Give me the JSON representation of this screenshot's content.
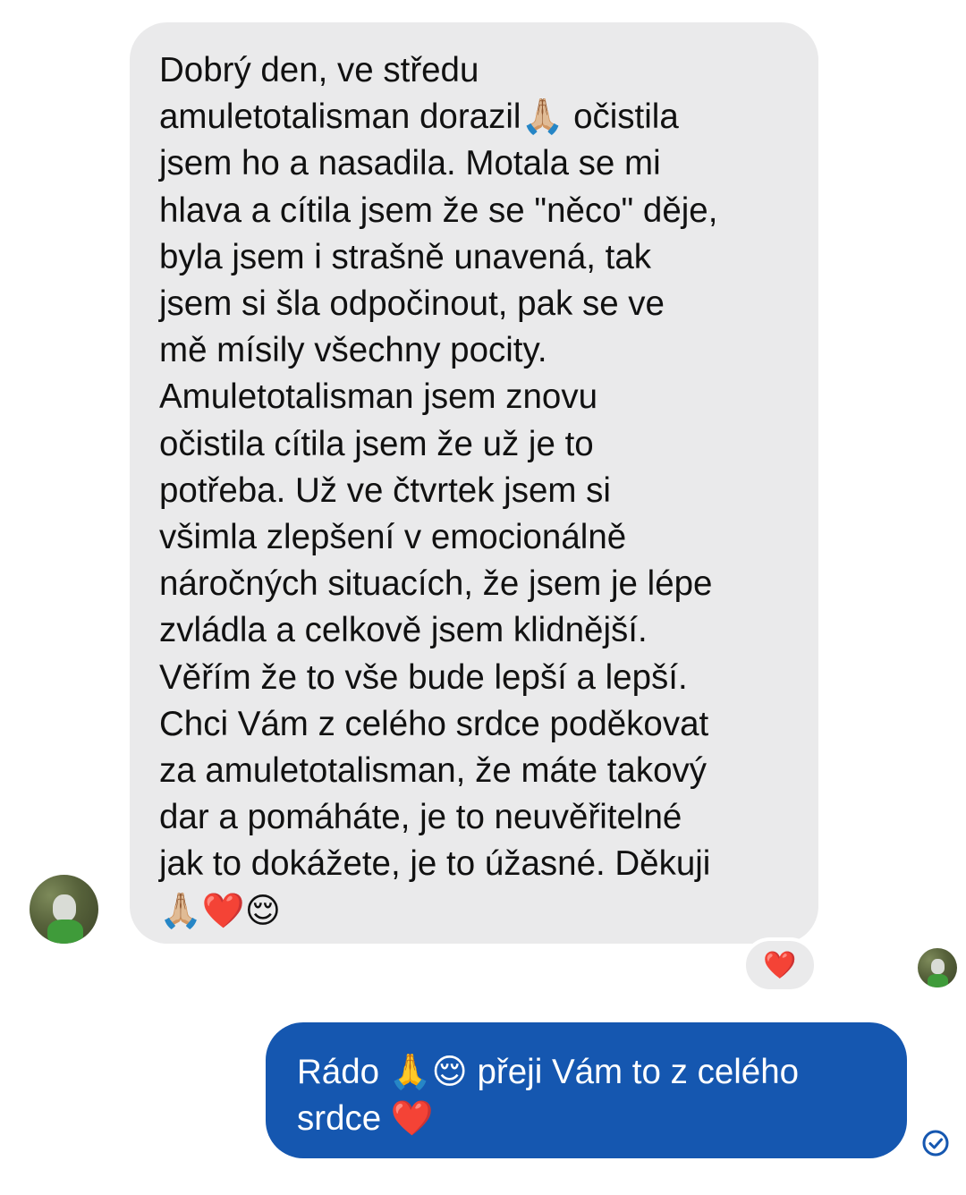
{
  "incoming_message": {
    "text": "Dobrý den, ve středu\namuletotalisman dorazil🙏🏼 očistila\njsem ho a nasadila. Motala se mi\nhlava a cítila jsem že se \"něco\" děje,\nbyla jsem i strašně unavená, tak\njsem si šla odpočinout, pak se ve\nmě mísily všechny pocity.\nAmuletotalisman jsem znovu\nočistila cítila jsem že už je to\npotřeba. Už ve čtvrtek jsem si\nvšimla zlepšení v emocionálně\nnáročných situacích, že jsem je lépe\nzvládla a celkově jsem klidnější.\nVěřím že to vše bude lepší a lepší.\nChci Vám z celého srdce poděkovat\nza amuletotalisman, že máte takový\ndar a pomáháte, je to neuvěřitelné\njak to dokážete, je to úžasné. Děkuji\n🙏🏼❤️😌",
    "reaction": "❤️"
  },
  "outgoing_message": {
    "text": "Rádo 🙏😌 přeji Vám to z celého\nsrdce ❤️"
  },
  "icons": {
    "sender_avatar": "contact-avatar",
    "seen_avatar": "seen-by-avatar",
    "read_receipt": "check-circle-icon"
  },
  "colors": {
    "incoming_bubble": "#eaeaeb",
    "outgoing_bubble": "#1557b0",
    "read_receipt": "#1557b0"
  }
}
